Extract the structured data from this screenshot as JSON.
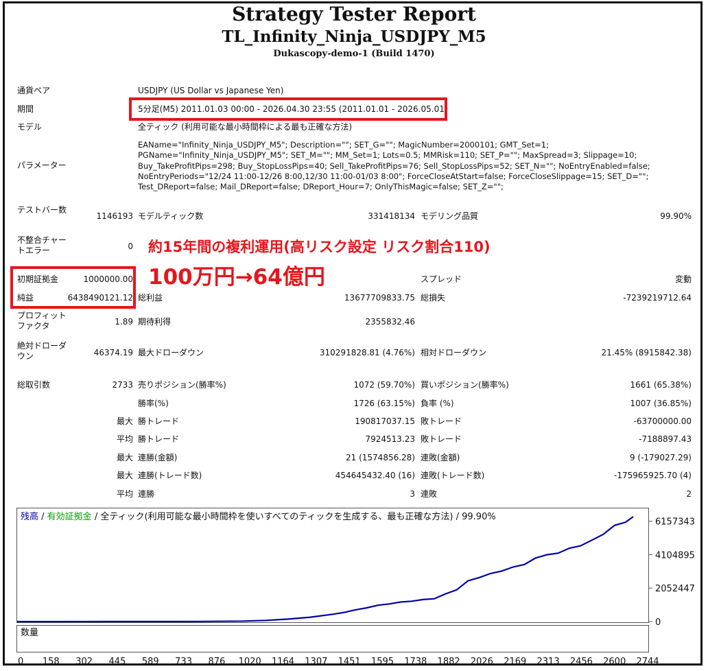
{
  "header": {
    "title": "Strategy Tester Report",
    "ea_name": "TL_Infinity_Ninja_USDJPY_M5",
    "server": "Dukascopy-demo-1 (Build 1470)"
  },
  "info": {
    "symbol_label": "通貨ペア",
    "symbol_value": "USDJPY (US Dollar vs Japanese Yen)",
    "period_label": "期間",
    "period_value": "5分足(M5) 2011.01.03 00:00 - 2026.04.30 23:55 (2011.01.01 - 2026.05.01)",
    "model_label": "モデル",
    "model_value": "全ティック (利用可能な最小時間枠による最も正確な方法)",
    "params_label": "パラメーター",
    "params_lines": [
      "EAName=\"Infinity_Ninja_USDJPY_M5\"; Description=\"\"; SET_G=\"\"; MagicNumber=2000101; GMT_Set=1;",
      "PGName=\"Infinity_Ninja_USDJPY_M5\"; SET_M=\"\"; MM_Set=1; Lots=0.5; MMRisk=110; SET_P=\"\"; MaxSpread=3; Slippage=10;",
      "Buy_TakeProfitPips=298; Buy_StopLossPips=40; Sell_TakeProfitPips=76; Sell_StopLossPips=52; SET_N=\"\"; NoEntryEnabled=false;",
      "NoEntryPeriods=\"12/24 11:00-12/26 8:00,12/30 11:00-01/03 8:00\"; ForceCloseAtStart=false; ForceCloseSlippage=15; SET_D=\"\";",
      "Test_DReport=false; Mail_DReport=false; DReport_Hour=7; OnlyThisMagic=false; SET_Z=\"\";"
    ]
  },
  "stats": {
    "bars_label": "テストバー数",
    "bars_value": "1146193",
    "ticks_label": "モデルティック数",
    "ticks_value": "331418134",
    "quality_label": "モデリング品質",
    "quality_value": "99.90%",
    "mismatch_label": "不整合チャートエラー",
    "mismatch_value": "0",
    "deposit_label": "初期証拠金",
    "deposit_value": "1000000.00",
    "spread_label": "スプレッド",
    "spread_value": "変動",
    "net_label": "純益",
    "net_value": "6438490121.12",
    "gross_profit_label": "総利益",
    "gross_profit_value": "13677709833.75",
    "gross_loss_label": "総損失",
    "gross_loss_value": "-7239219712.64",
    "pf_label": "プロフィットファクタ",
    "pf_value": "1.89",
    "expected_label": "期待利得",
    "expected_value": "2355832.46",
    "abs_dd_label": "絶対ドローダウン",
    "abs_dd_value": "46374.19",
    "max_dd_label": "最大ドローダウン",
    "max_dd_value": "310291828.81 (4.76%)",
    "rel_dd_label": "相対ドローダウン",
    "rel_dd_value": "21.45% (8915842.38)",
    "trades_label": "総取引数",
    "trades_value": "2733",
    "short_label": "売りポジション(勝率%)",
    "short_value": "1072 (59.70%)",
    "long_label": "買いポジション(勝率%)",
    "long_value": "1661 (65.38%)",
    "win_pct_label": "勝率(%)",
    "win_pct_value": "1726 (63.15%)",
    "loss_pct_label": "負率 (%)",
    "loss_pct_value": "1007 (36.85%)",
    "max_label": "最大",
    "avg_label": "平均",
    "largest_win_label": "勝トレード",
    "largest_win_value": "190817037.15",
    "largest_loss_label": "敗トレード",
    "largest_loss_value": "-63700000.00",
    "avg_win_label": "勝トレード",
    "avg_win_value": "7924513.23",
    "avg_loss_label": "敗トレード",
    "avg_loss_value": "-7188897.43",
    "max_consec_wins_label": "連勝(金額)",
    "max_consec_wins_value": "21 (1574856.28)",
    "max_consec_losses_label": "連敗(金額)",
    "max_consec_losses_value": "9 (-179027.29)",
    "max_consec_profit_label": "連勝(トレード数)",
    "max_consec_profit_value": "454645432.40 (16)",
    "max_consec_loss_label": "連敗(トレード数)",
    "max_consec_loss_value": "-175965925.70 (4)",
    "avg_consec_wins_label": "連勝",
    "avg_consec_wins_value": "3",
    "avg_consec_losses_label": "連敗",
    "avg_consec_losses_value": "2"
  },
  "annotation": {
    "line1": "約15年間の複利運用(高リスク設定 リスク割合110)",
    "line2": "100万円→64億円",
    "color": "#e5161d"
  },
  "chart_data": {
    "type": "line",
    "legend_balance": "残高",
    "legend_sep1": " / ",
    "legend_equity": "有効証拠金",
    "legend_rest": " / 全ティック(利用可能な最小時間枠を使いすべてのティックを生成する、最も正確な方法) / 99.90%",
    "balance_color": "#0000a8",
    "equity_color": "#00a000",
    "volume_label": "数量",
    "volume_color": "#00bb00",
    "y_ticks": [
      "0",
      "2052447",
      "4104895",
      "6157343"
    ],
    "ylim": [
      0,
      6500000
    ],
    "xlim": [
      0,
      2800
    ],
    "x_ticks": [
      "0",
      "158",
      "302",
      "445",
      "589",
      "733",
      "876",
      "1020",
      "1164",
      "1307",
      "1451",
      "1595",
      "1738",
      "1882",
      "2026",
      "2169",
      "2313",
      "2456",
      "2600",
      "2744"
    ],
    "series": [
      {
        "x": [
          0,
          200,
          400,
          600,
          800,
          1000,
          1100,
          1200,
          1300,
          1400,
          1450,
          1500,
          1550,
          1600,
          1650,
          1700,
          1750,
          1800,
          1850,
          1900,
          1950,
          2000,
          2050,
          2100,
          2150,
          2200,
          2250,
          2300,
          2350,
          2400,
          2450,
          2500,
          2550,
          2600,
          2650,
          2700,
          2733
        ],
        "values": [
          1000,
          1500,
          2500,
          4000,
          8000,
          30000,
          70000,
          150000,
          270000,
          450000,
          560000,
          720000,
          840000,
          1000000,
          1080000,
          1200000,
          1250000,
          1350000,
          1400000,
          1700000,
          1950000,
          2500000,
          2700000,
          2950000,
          3100000,
          3350000,
          3500000,
          3900000,
          4100000,
          4200000,
          4500000,
          4650000,
          5000000,
          5350000,
          5900000,
          6100000,
          6438490
        ]
      }
    ],
    "volume": {
      "start": 1000,
      "ramp_end": 1450,
      "end": 2733,
      "max": 1.0
    }
  }
}
